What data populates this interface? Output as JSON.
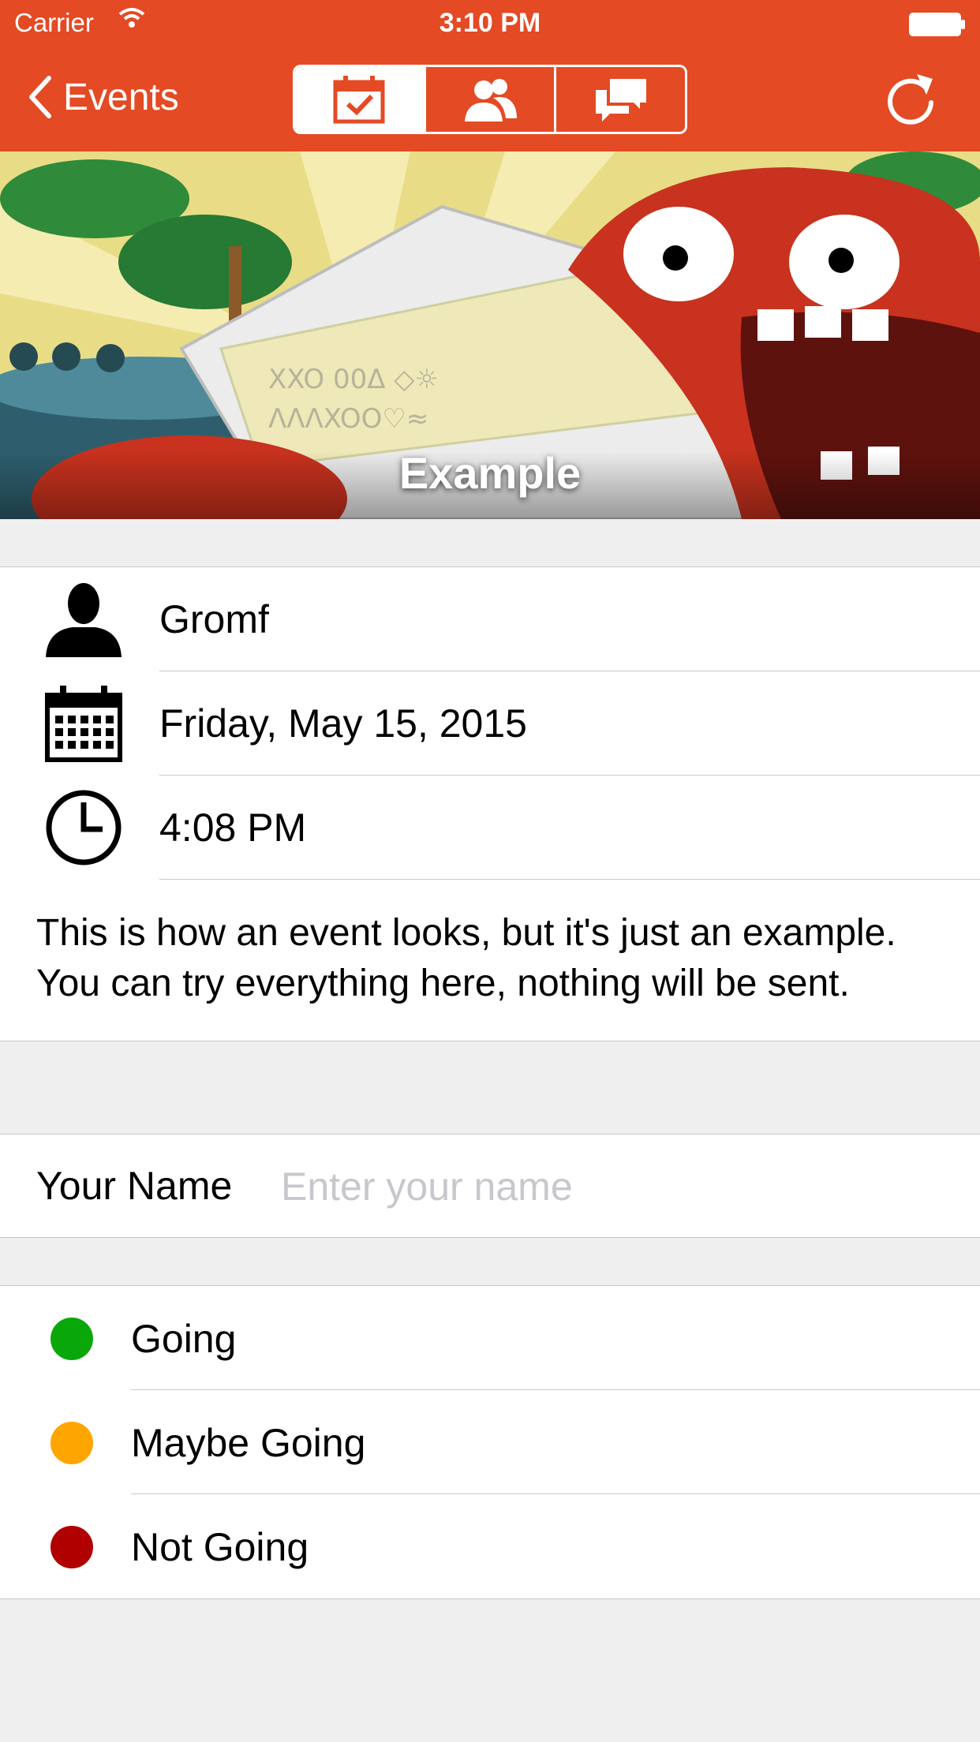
{
  "status_bar": {
    "carrier": "Carrier",
    "time": "3:10 PM"
  },
  "navbar": {
    "back_label": "Events",
    "segments": [
      {
        "icon": "calendar-check-icon",
        "active": true
      },
      {
        "icon": "people-icon",
        "active": false
      },
      {
        "icon": "chat-bubbles-icon",
        "active": false
      }
    ],
    "refresh_icon": "refresh-icon"
  },
  "hero": {
    "title": "Example"
  },
  "details": {
    "organizer": "Gromf",
    "date": "Friday, May 15, 2015",
    "time": "4:08 PM",
    "description": "This is how an event looks, but it's just an example. You can try everything here, nothing will be sent."
  },
  "name_field": {
    "label": "Your Name",
    "placeholder": "Enter your name",
    "value": ""
  },
  "rsvp": [
    {
      "label": "Going",
      "color": "#0aa70a"
    },
    {
      "label": "Maybe Going",
      "color": "#ffa500"
    },
    {
      "label": "Not Going",
      "color": "#b00000"
    }
  ],
  "colors": {
    "accent": "#e44a24",
    "background": "#efefef"
  }
}
